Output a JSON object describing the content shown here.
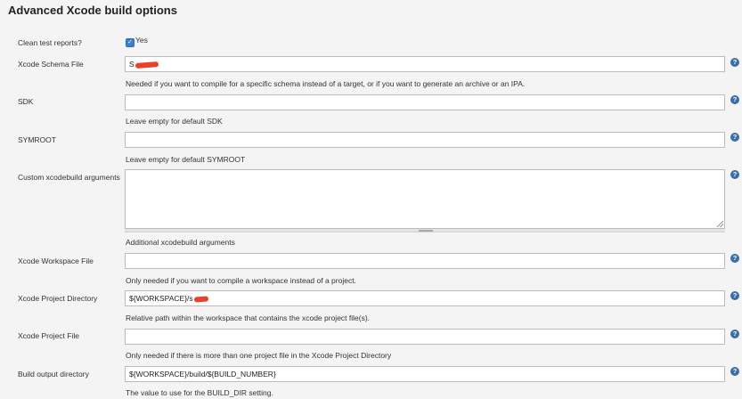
{
  "title": "Advanced Xcode build options",
  "clean_test_reports": {
    "label": "Clean test reports?",
    "checked": true,
    "option_label": "Yes"
  },
  "schema_file": {
    "label": "Xcode Schema File",
    "value": "S",
    "help": "Needed if you want to compile for a specific schema instead of a target, or if you want to generate an archive or an IPA."
  },
  "sdk": {
    "label": "SDK",
    "value": "",
    "help": "Leave empty for default SDK"
  },
  "symroot": {
    "label": "SYMROOT",
    "value": "",
    "help": "Leave empty for default SYMROOT"
  },
  "custom_args": {
    "label": "Custom xcodebuild arguments",
    "value": "",
    "help": "Additional xcodebuild arguments"
  },
  "workspace_file": {
    "label": "Xcode Workspace File",
    "value": "",
    "help": "Only needed if you want to compile a workspace instead of a project."
  },
  "project_directory": {
    "label": "Xcode Project Directory",
    "value": "${WORKSPACE}/s",
    "help": "Relative path within the workspace that contains the xcode project file(s)."
  },
  "project_file": {
    "label": "Xcode Project File",
    "value": "",
    "help": "Only needed if there is more than one project file in the Xcode Project Directory"
  },
  "build_output_directory": {
    "label": "Build output directory",
    "value": "${WORKSPACE}/build/${BUILD_NUMBER}",
    "help": "The value to use for the BUILD_DIR setting."
  },
  "help_icon_glyph": "?",
  "icons": {
    "help": "help-question-icon",
    "checkbox": "checkmark-icon"
  },
  "colors": {
    "help_icon": "#3a6ea5",
    "checkbox": "#3d7fcf",
    "redaction": "#e8412c"
  }
}
